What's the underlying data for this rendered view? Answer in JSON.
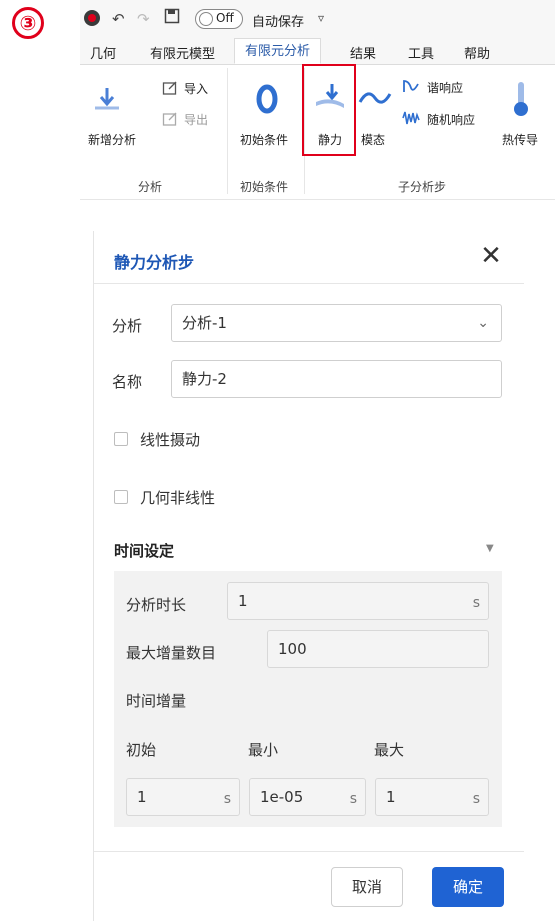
{
  "step_marker": "③",
  "quick_access": {
    "toggle_label": "Off",
    "autosave_label": "自动保存",
    "dropdown_glyph": "▿"
  },
  "ribbon": {
    "tabs": [
      "几何",
      "有限元模型",
      "有限元分析",
      "结果",
      "工具",
      "帮助"
    ],
    "active_tab": "有限元分析",
    "tools": {
      "new_analysis": "新增分析",
      "import": "导入",
      "export": "导出",
      "initial_conditions": "初始条件",
      "static": "静力",
      "modal": "模态",
      "harmonic": "谐响应",
      "random": "随机响应",
      "heat_transfer": "热传导"
    },
    "groups": {
      "analysis": "分析",
      "initial_conditions": "初始条件",
      "sub_steps": "子分析步"
    }
  },
  "dialog": {
    "title": "静力分析步",
    "analysis_label": "分析",
    "analysis_value": "分析-1",
    "name_label": "名称",
    "name_value": "静力-2",
    "linear_perturbation": "线性摄动",
    "geometric_nonlinear": "几何非线性",
    "time_settings": {
      "title": "时间设定",
      "duration_label": "分析时长",
      "duration_value": "1",
      "max_increments_label": "最大增量数目",
      "max_increments_value": "100",
      "increment_label": "时间增量",
      "initial_label": "初始",
      "min_label": "最小",
      "max_label": "最大",
      "initial_value": "1",
      "min_value": "1e-05",
      "max_value": "1",
      "unit": "s"
    },
    "cancel": "取消",
    "ok": "确定"
  },
  "colors": {
    "accent": "#1f63d3",
    "highlight": "#e0001b",
    "title": "#1e57b5"
  }
}
